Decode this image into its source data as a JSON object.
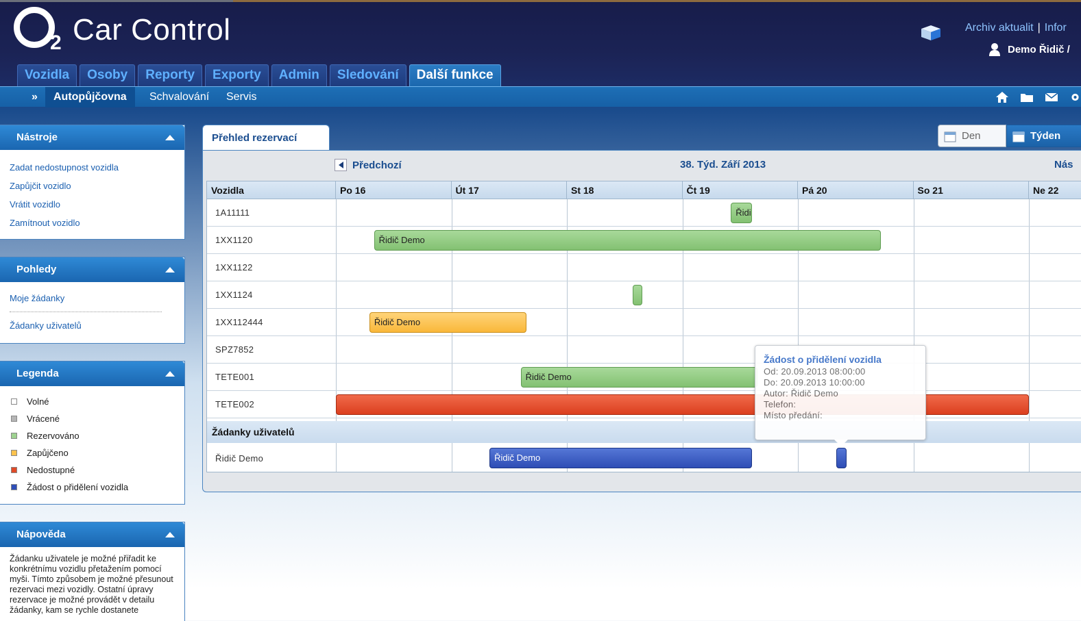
{
  "header": {
    "logo_letter": "O",
    "logo_sub": "2",
    "app_title": "Car Control",
    "links": [
      "Archiv aktualit",
      "Infor"
    ],
    "link_separator": "|",
    "user": "Demo Řidič /"
  },
  "main_tabs": [
    "Vozidla",
    "Osoby",
    "Reporty",
    "Exporty",
    "Admin",
    "Sledování",
    "Další funkce"
  ],
  "subnav": {
    "arrow": "»",
    "items": [
      "Autopůjčovna",
      "Schvalování",
      "Servis"
    ]
  },
  "sidebar": {
    "tools": {
      "title": "Nástroje",
      "links": [
        "Zadat nedostupnost vozidla",
        "Zapůjčit vozidlo",
        "Vrátit vozidlo",
        "Zamítnout vozidlo"
      ]
    },
    "views": {
      "title": "Pohledy",
      "links": [
        "Moje žádanky",
        "Žádanky uživatelů"
      ]
    },
    "legend": {
      "title": "Legenda",
      "items": [
        {
          "label": "Volné",
          "color": "#ffffff"
        },
        {
          "label": "Vrácené",
          "color": "#b5b5b5"
        },
        {
          "label": "Rezervováno",
          "color": "#9ed290"
        },
        {
          "label": "Zapůjčeno",
          "color": "#fcc24d"
        },
        {
          "label": "Nedostupné",
          "color": "#e04a28"
        },
        {
          "label": "Žádost o přidělení vozidla",
          "color": "#2f4fb8"
        }
      ]
    },
    "help": {
      "title": "Nápověda",
      "text": "Žádanku uživatele je možné přiřadit ke konkrétnímu vozidlu přetažením pomocí myši. Tímto způsobem je možné přesunout rezervaci mezi vozidly. Ostatní úpravy rezervace je možné provádět v detailu žádanky, kam se rychle dostanete"
    }
  },
  "overview": {
    "tab_label": "Přehled rezervací",
    "view_day": "Den",
    "view_week": "Týden",
    "prev": "Předchozí",
    "week_title": "38. Týd. Září 2013",
    "next": "Nás",
    "grid_header": "Vozidla",
    "days": [
      "Po 16",
      "Út 17",
      "St 18",
      "Čt 19",
      "Pá 20",
      "So 21",
      "Ne 22"
    ],
    "vehicles": [
      "1A11111",
      "1XX1120",
      "1XX1122",
      "1XX1124",
      "1XX112444",
      "SPZ7852",
      "TETE001",
      "TETE002"
    ],
    "section_title": "Žádanky uživatelů",
    "request_rows": [
      "Řidič Demo"
    ],
    "bars": [
      {
        "row": 0,
        "status": "green",
        "label": "Řidič Demo",
        "start_day": 3.42,
        "end_day": 3.6
      },
      {
        "row": 1,
        "status": "green",
        "label": "Řidič Demo",
        "start_day": 0.33,
        "end_day": 4.72
      },
      {
        "row": 3,
        "status": "green",
        "label": "",
        "start_day": 2.57,
        "end_day": 2.65
      },
      {
        "row": 4,
        "status": "orange",
        "label": "Řidič Demo",
        "start_day": 0.29,
        "end_day": 1.65
      },
      {
        "row": 6,
        "status": "green",
        "label": "Řidič Demo",
        "start_day": 1.6,
        "end_day": 3.65
      },
      {
        "row": 7,
        "status": "red",
        "label": "",
        "start_day": 0.0,
        "end_day": 6.0
      },
      {
        "row": 9,
        "status": "blue",
        "label": "Řidič Demo",
        "start_day": 1.33,
        "end_day": 3.6
      },
      {
        "row": 9,
        "status": "blue",
        "label": "",
        "start_day": 4.33,
        "end_day": 4.42
      }
    ]
  },
  "tooltip": {
    "title": "Žádost o přidělení vozidla",
    "lines": [
      "Od: 20.09.2013 08:00:00",
      "Do: 20.09.2013 10:00:00",
      "Autor: Řidič Demo",
      "Telefon:",
      "Místo předání:"
    ]
  }
}
